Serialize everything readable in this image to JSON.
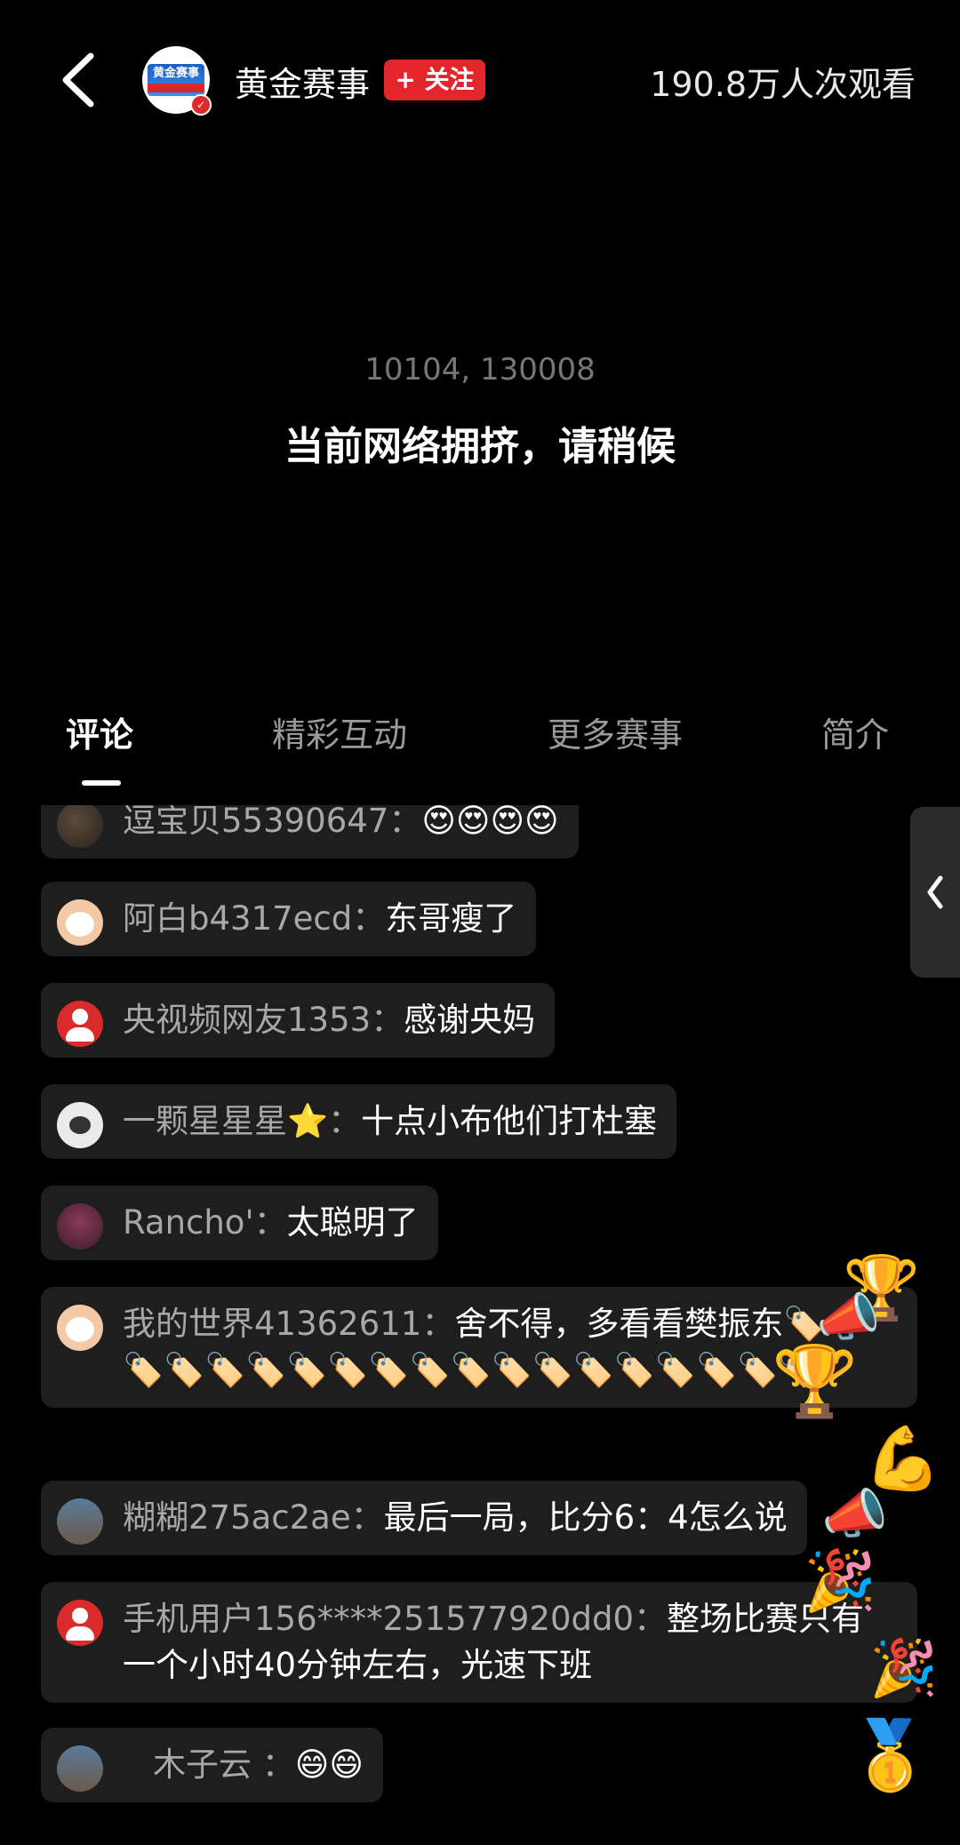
{
  "header": {
    "channel_name": "黄金赛事",
    "logo_text": "黄金赛事",
    "follow_label": "+ 关注",
    "viewers": "190.8万人次观看"
  },
  "player": {
    "error_code": "10104, 130008",
    "error_message": "当前网络拥挤，请稍候"
  },
  "tabs": [
    "评论",
    "精彩互动",
    "更多赛事",
    "简介"
  ],
  "comments": [
    {
      "user": "逗宝贝55390647：",
      "text": "😍😍😍😍"
    },
    {
      "user": "阿白b4317ecd：",
      "text": "东哥瘦了"
    },
    {
      "user": "央视频网友1353：",
      "text": "感谢央妈"
    },
    {
      "user": "一颗星星星⭐：",
      "text": "十点小布他们打杜塞"
    },
    {
      "user": "Rancho'：",
      "text": "太聪明了"
    },
    {
      "user": "我的世界41362611：",
      "text": "舍不得，多看看樊振东🏷️🏷️🏷️🏷️🏷️🏷️🏷️🏷️🏷️🏷️🏷️🏷️🏷️🏷️🏷️🏷️🏷️🏷️"
    },
    {
      "user": "糊糊275ac2ae：",
      "text": "最后一局，比分6：4怎么说"
    },
    {
      "user": "手机用户156****251577920dd0：",
      "text": "整场比赛只有一个小时40分钟左右，光速下班"
    },
    {
      "user": "木子云 ：",
      "text": "😄😄"
    }
  ],
  "side_handle_icon": "chevron-left-icon",
  "floating_reactions": [
    "🏆",
    "📣",
    "🏆",
    "💪",
    "📣",
    "🎉",
    "🎉",
    "🥇"
  ],
  "colors": {
    "background": "#000000",
    "follow_button": "#e3262b",
    "bubble": "#1e1e1e",
    "nickname": "#a8a8a8"
  }
}
